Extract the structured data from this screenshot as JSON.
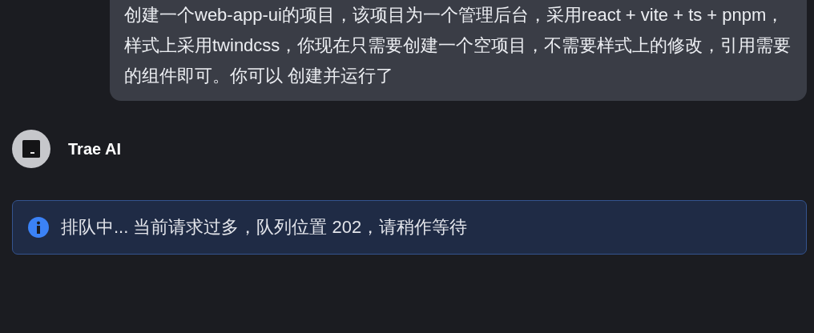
{
  "user_message": {
    "text": "创建一个web-app-ui的项目，该项目为一个管理后台，采用react + vite + ts + pnpm，样式上采用twindcss，你现在只需要创建一个空项目，不需要样式上的修改，引用需要的组件即可。你可以 创建并运行了"
  },
  "assistant": {
    "name": "Trae AI"
  },
  "notice": {
    "kind": "info",
    "text": "排队中... 当前请求过多，队列位置 202，请稍作等待"
  }
}
